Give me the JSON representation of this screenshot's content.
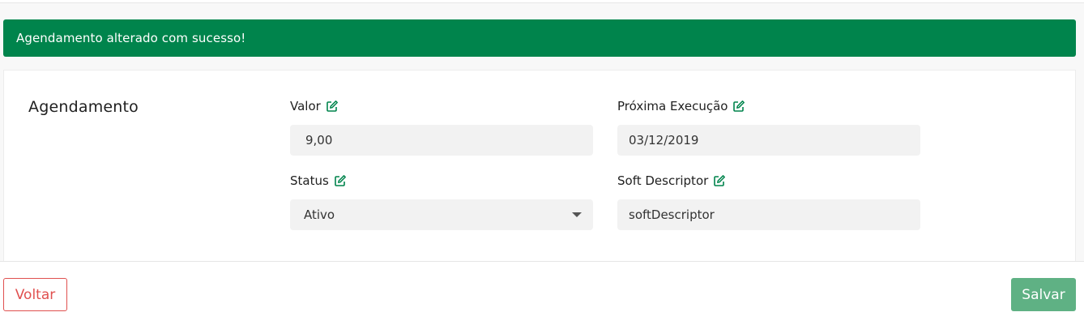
{
  "alert": {
    "message": "Agendamento alterado com sucesso!"
  },
  "section": {
    "title": "Agendamento"
  },
  "fields": {
    "valor": {
      "label": "Valor",
      "value": "9,00"
    },
    "proxima_execucao": {
      "label": "Próxima Execução",
      "value": "03/12/2019"
    },
    "status": {
      "label": "Status",
      "value": "Ativo"
    },
    "soft_descriptor": {
      "label": "Soft Descriptor",
      "value": "softDescriptor"
    }
  },
  "footer": {
    "back_label": "Voltar",
    "save_label": "Salvar"
  },
  "colors": {
    "success": "#00844c",
    "edit_icon": "#00844c",
    "danger": "#e0504f",
    "save_button": "#5fb184"
  },
  "icons": {
    "edit": "edit-icon",
    "dropdown": "chevron-down-icon"
  }
}
